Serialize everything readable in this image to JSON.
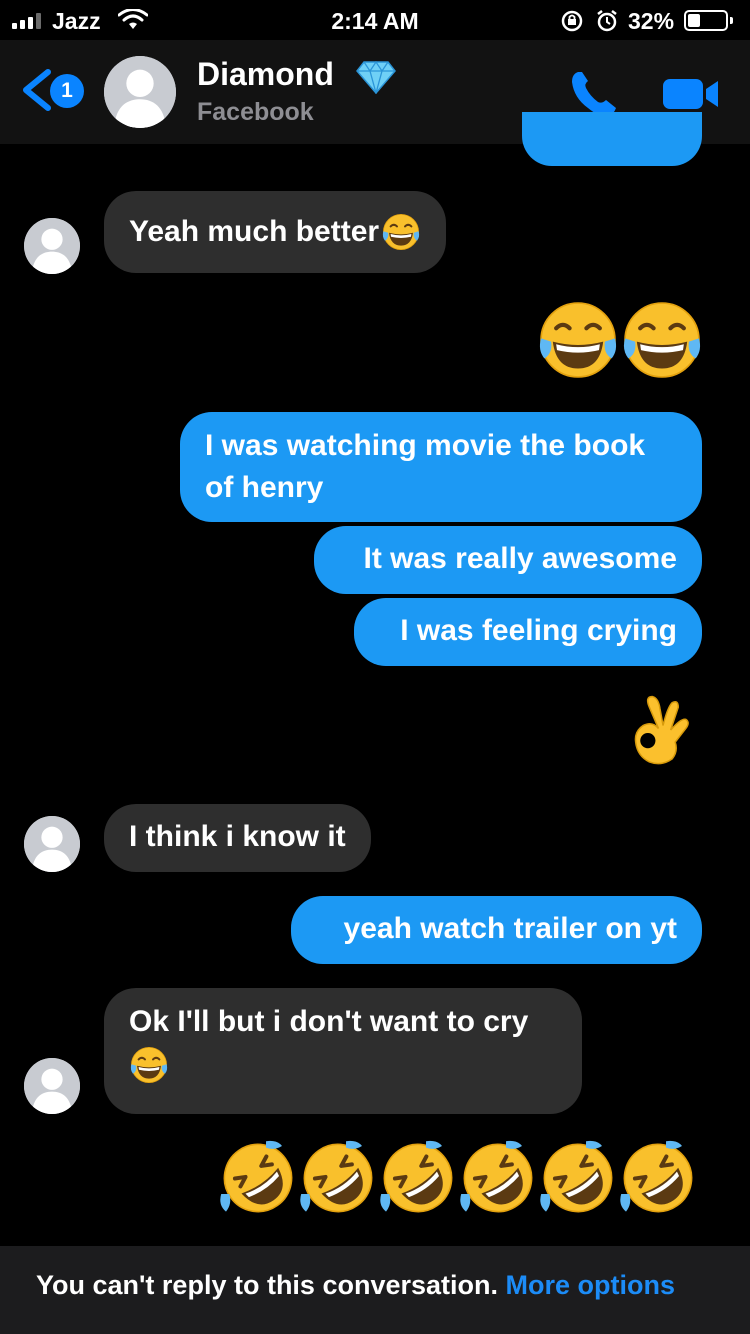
{
  "status_bar": {
    "carrier": "Jazz",
    "time": "2:14 AM",
    "battery": "32%",
    "battery_level": 0.32,
    "icons": [
      "signal-icon",
      "wifi-icon",
      "orientation-lock-icon",
      "alarm-icon",
      "battery-icon"
    ]
  },
  "header": {
    "back_badge": "1",
    "contact_name": "Diamond",
    "contact_sub": "Facebook",
    "icons": [
      "back-chevron-icon",
      "avatar-placeholder-icon",
      "diamond-icon",
      "phone-icon",
      "video-camera-icon"
    ]
  },
  "messages": [
    {
      "from": "me",
      "text": "",
      "note": "partially visible bubble"
    },
    {
      "from": "them",
      "text": "Yeah much better",
      "emoji": "face-with-tears-of-joy"
    },
    {
      "from": "me",
      "emoji": "face-with-tears-of-joy x2"
    },
    {
      "from": "me",
      "text_line1": "I was watching movie the book",
      "text_line2": "of henry"
    },
    {
      "from": "me",
      "text": "It was really awesome"
    },
    {
      "from": "me",
      "text": "I was feeling crying"
    },
    {
      "from": "me",
      "emoji": "ok-hand"
    },
    {
      "from": "them",
      "text": "I think i know it"
    },
    {
      "from": "me",
      "text": "yeah watch trailer on yt"
    },
    {
      "from": "them",
      "text": "Ok I'll but i don't want to cry",
      "emoji": "face-with-tears-of-joy"
    },
    {
      "from": "me",
      "emoji": "rolling-on-the-floor-laughing x6"
    }
  ],
  "footer": {
    "text": "You can't reply to this conversation.",
    "link": "More options"
  },
  "colors": {
    "background": "#000000",
    "outgoing_bubble": "#1c99f4",
    "incoming_bubble": "#2e2e2e",
    "link": "#1c8cf7",
    "accent": "#0a84ff"
  }
}
